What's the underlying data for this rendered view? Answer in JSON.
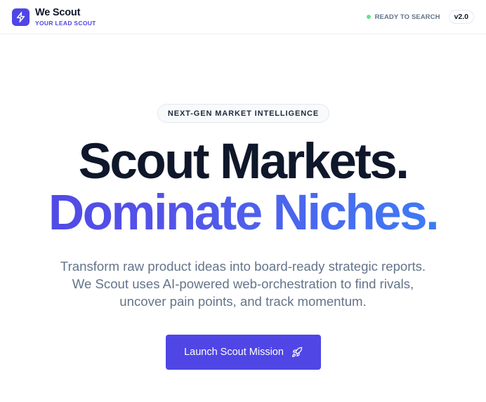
{
  "header": {
    "brand_name": "We Scout",
    "brand_tagline": "YOUR LEAD SCOUT",
    "status_text": "READY TO SEARCH",
    "version": "v2.0",
    "logo_icon": "lightning-bolt-icon"
  },
  "hero": {
    "eyebrow": "NEXT-GEN MARKET INTELLIGENCE",
    "headline_line1": "Scout Markets.",
    "headline_line2": "Dominate Niches.",
    "description_lines": [
      "Transform raw product ideas into board-ready strategic reports.",
      "We Scout uses AI-powered web-orchestration to find rivals,",
      "uncover pain points, and track momentum."
    ],
    "cta_label": "Launch Scout Mission",
    "cta_icon": "rocket-icon"
  },
  "colors": {
    "accent": "#4f46e5",
    "gradient_end": "#3b82f6",
    "status_dot": "#4ade80",
    "text_primary": "#0f172a",
    "text_muted": "#64748b"
  }
}
